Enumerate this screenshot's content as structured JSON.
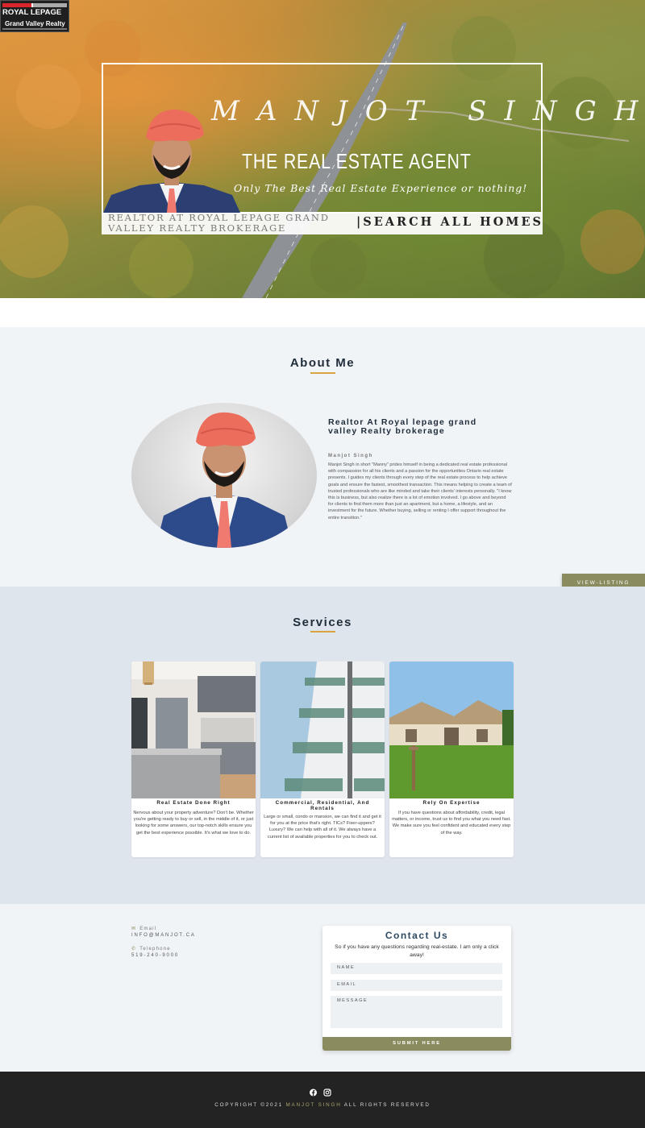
{
  "logo": {
    "brand": "ROYAL LEPAGE",
    "office": "Grand Valley Realty"
  },
  "hero": {
    "name": "MANJOT SINGH",
    "role": "THE REAL ESTATE AGENT",
    "tagline": "Only The Best Real Estate Experience or nothing!",
    "realtor_line": "REALTOR AT ROYAL LEPAGE GRAND VALLEY REALTY BROKERAGE",
    "search_link": "|SEARCH ALL HOMES"
  },
  "about": {
    "title": "About Me",
    "heading": "Realtor At Royal lepage grand valley Realty brokerage",
    "subname": "Manjot Singh",
    "body": "Manjot Singh in short \"Manny\" prides himself in being a dedicated real estate professional with compassion for all his clients and a passion for the opportunities Ontario real estate presents. I guides my clients through every step of the real estate process to help achieve goals and ensure the fastest, smoothest transaction. This means helping to create a team of trusted professionals who are like minded and take their clients' interests personally. \"I know this is business, but also realize there is a lot of emotion involved. I go above and beyond for clients to find them more than just an apartment, but a home, a lifestyle, and an investment for the future. Whether buying, selling or renting I offer support throughout the entire transition.\"",
    "view_listing": "VIEW-LISTING"
  },
  "services": {
    "title": "Services",
    "cards": [
      {
        "title": "Real Estate Done Right",
        "text": "Nervous about your property adventure? Don't be. Whether you're getting ready to buy or sell, in the middle of it, or just looking for some answers, our top-notch skills ensure you get the best experience possible. It's what we love to do."
      },
      {
        "title": "Commercial, Residential, And Rentals",
        "text": "Large or small, condo or mansion, we can find it and get it for you at the price that's right. TICs? Fixer-uppers? Luxury? We can help with all of it. We always have a current list of available properties for you to check out."
      },
      {
        "title": "Rely On Expertise",
        "text": "If you have questions about affordability, credit, legal matters, or income, trust us to find you what you need fast. We make sure you feel confident and educated every step of the way."
      }
    ]
  },
  "contact": {
    "email_label": "Email",
    "email_value": "INFO@MANJOT.CA",
    "phone_label": "Telephone",
    "phone_value": "519-240-9000",
    "form_title": "Contact Us",
    "form_sub": "So if you have any questions regarding real-estate. I am only a click away!",
    "name_placeholder": "NAME",
    "email_placeholder": "EMAIL",
    "message_placeholder": "MESSAGE",
    "submit": "SUBMIT HERE"
  },
  "footer": {
    "copy_prefix": "COPYRIGHT ©2021",
    "copy_name": "MANJOT SINGH",
    "copy_suffix": "ALL RIGHTS RESERVED"
  },
  "colors": {
    "accent": "#8a8b5e",
    "heading": "#1f2c3a",
    "underline": "#d9a441",
    "footer_bg": "#232323"
  }
}
